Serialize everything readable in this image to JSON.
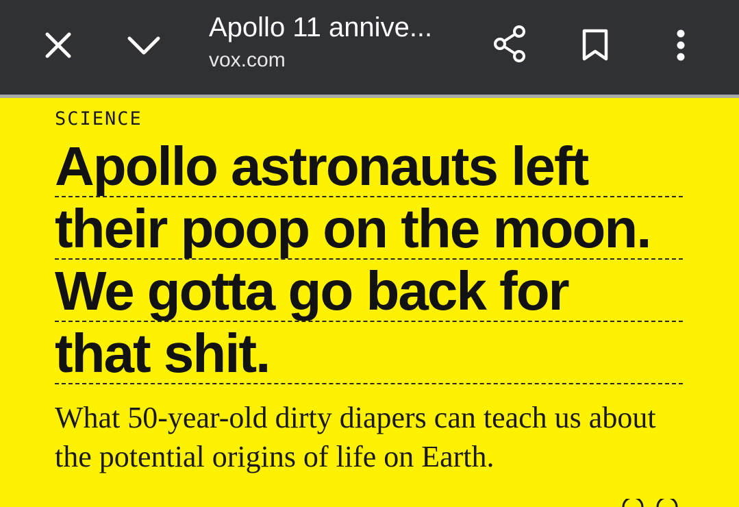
{
  "browser": {
    "title": "Apollo 11 annive...",
    "domain": "vox.com",
    "icons": {
      "close": "close-icon",
      "minimize": "chevron-down-icon",
      "share": "share-icon",
      "bookmark": "bookmark-icon",
      "menu": "more-vert-icon"
    },
    "colors": {
      "toolbar": "#303134",
      "toolbar_text": "#ffffff"
    }
  },
  "article": {
    "kicker": "SCIENCE",
    "headline_lines": [
      "Apollo astronauts left",
      "their poop on the moon.",
      "We gotta go back for",
      "that shit."
    ],
    "dek": "What 50-year-old dirty diapers can teach us about the potential origins of life on Earth.",
    "colors": {
      "background": "#fff200",
      "text": "#121212"
    }
  }
}
